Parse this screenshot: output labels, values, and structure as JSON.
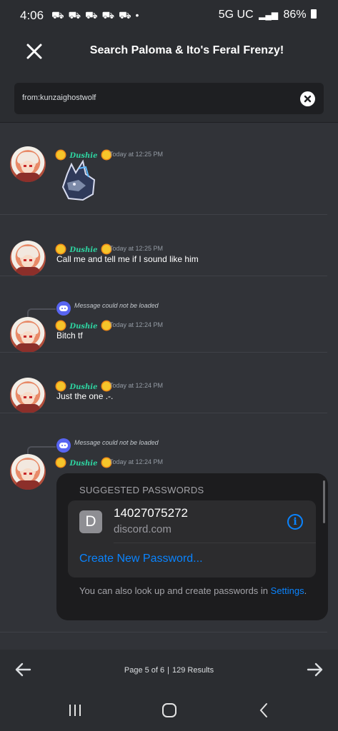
{
  "status_bar": {
    "time": "4:06",
    "notifications": "⛟ ⛟ ⛟ ⛟ ⛟ •",
    "network": "5G UC",
    "battery": "86%"
  },
  "header": {
    "title": "Search Paloma & Ito's Feral Frenzy!"
  },
  "search": {
    "value": "from:kunzaighostwolf"
  },
  "results": [
    {
      "username": "Dushie",
      "timestamp": "Today at 12:25 PM",
      "message": "",
      "has_sticker": true
    },
    {
      "username": "Dushie",
      "timestamp": "Today at 12:25 PM",
      "message": "Call me and tell me if I sound like him"
    },
    {
      "username": "Dushie",
      "timestamp": "Today at 12:24 PM",
      "message": "Bitch tf",
      "reply_text": "Message could not be loaded"
    },
    {
      "username": "Dushie",
      "timestamp": "Today at 12:24 PM",
      "message": "Just the one .-."
    },
    {
      "username": "Dushie",
      "timestamp": "Today at 12:24 PM",
      "message": "",
      "reply_text": "Message could not be loaded"
    }
  ],
  "password_popover": {
    "heading": "SUGGESTED PASSWORDS",
    "site_letter": "D",
    "saved_value": "14027075272",
    "site": "discord.com",
    "create_label": "Create New Password...",
    "footer_text": "You can also look up and create passwords in",
    "footer_link": "Settings",
    "footer_end": "."
  },
  "pager": {
    "page_text": "Page 5 of 6",
    "separator": "|",
    "results_text": "129 Results"
  },
  "colors": {
    "background": "#313338",
    "header": "#2b2d31",
    "username": "#2ed3a0",
    "ios_blue": "#0a84ff",
    "discord_blurple": "#5865f2"
  }
}
